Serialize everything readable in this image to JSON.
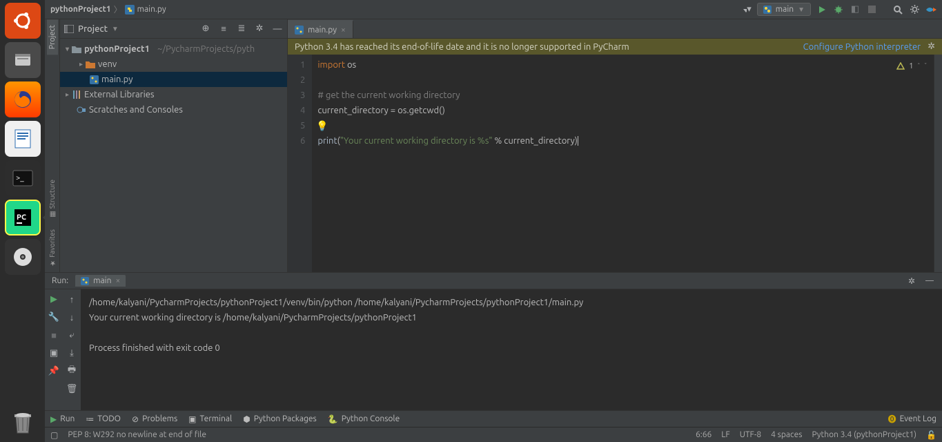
{
  "breadcrumb": {
    "project": "pythonProject1",
    "file": "main.py"
  },
  "runConfig": "main",
  "projectPanel": {
    "title": "Project",
    "root": "pythonProject1",
    "rootPath": "~/PycharmProjects/pyth",
    "venv": "venv",
    "mainFile": "main.py",
    "extLib": "External Libraries",
    "scratches": "Scratches and Consoles"
  },
  "editor": {
    "tab": "main.py",
    "bannerMsg": "Python 3.4 has reached its end-of-life date and it is no longer supported in PyCharm",
    "bannerLink": "Configure Python interpreter",
    "problemsCount": "1",
    "lines": [
      "1",
      "2",
      "3",
      "4",
      "5",
      "6"
    ]
  },
  "code": {
    "l1_kw": "import",
    "l1_mod": " os",
    "l3_cmt": "# get the current working directory",
    "l4": "current_directory = os.getcwd()",
    "l6_fn": "print",
    "l6_p1": "(",
    "l6_str": "\"Your current working directory is %s\"",
    "l6_mid": " % current_directory",
    "l6_p2": ")"
  },
  "run": {
    "title": "Run:",
    "tabName": "main",
    "line1": "/home/kalyani/PycharmProjects/pythonProject1/venv/bin/python /home/kalyani/PycharmProjects/pythonProject1/main.py",
    "line2": "Your current working directory is /home/kalyani/PycharmProjects/pythonProject1",
    "line3": "",
    "line4": "Process finished with exit code 0"
  },
  "toolStrip": {
    "run": "Run",
    "todo": "TODO",
    "problems": "Problems",
    "terminal": "Terminal",
    "pyPackages": "Python Packages",
    "pyConsole": "Python Console",
    "eventLog": "Event Log"
  },
  "status": {
    "pep8": "PEP 8: W292 no newline at end of file",
    "pos": "6:66",
    "lf": "LF",
    "enc": "UTF-8",
    "indent": "4 spaces",
    "interp": "Python 3.4 (pythonProject1)"
  },
  "gutters": {
    "project": "Project",
    "structure": "Structure",
    "favorites": "Favorites"
  }
}
